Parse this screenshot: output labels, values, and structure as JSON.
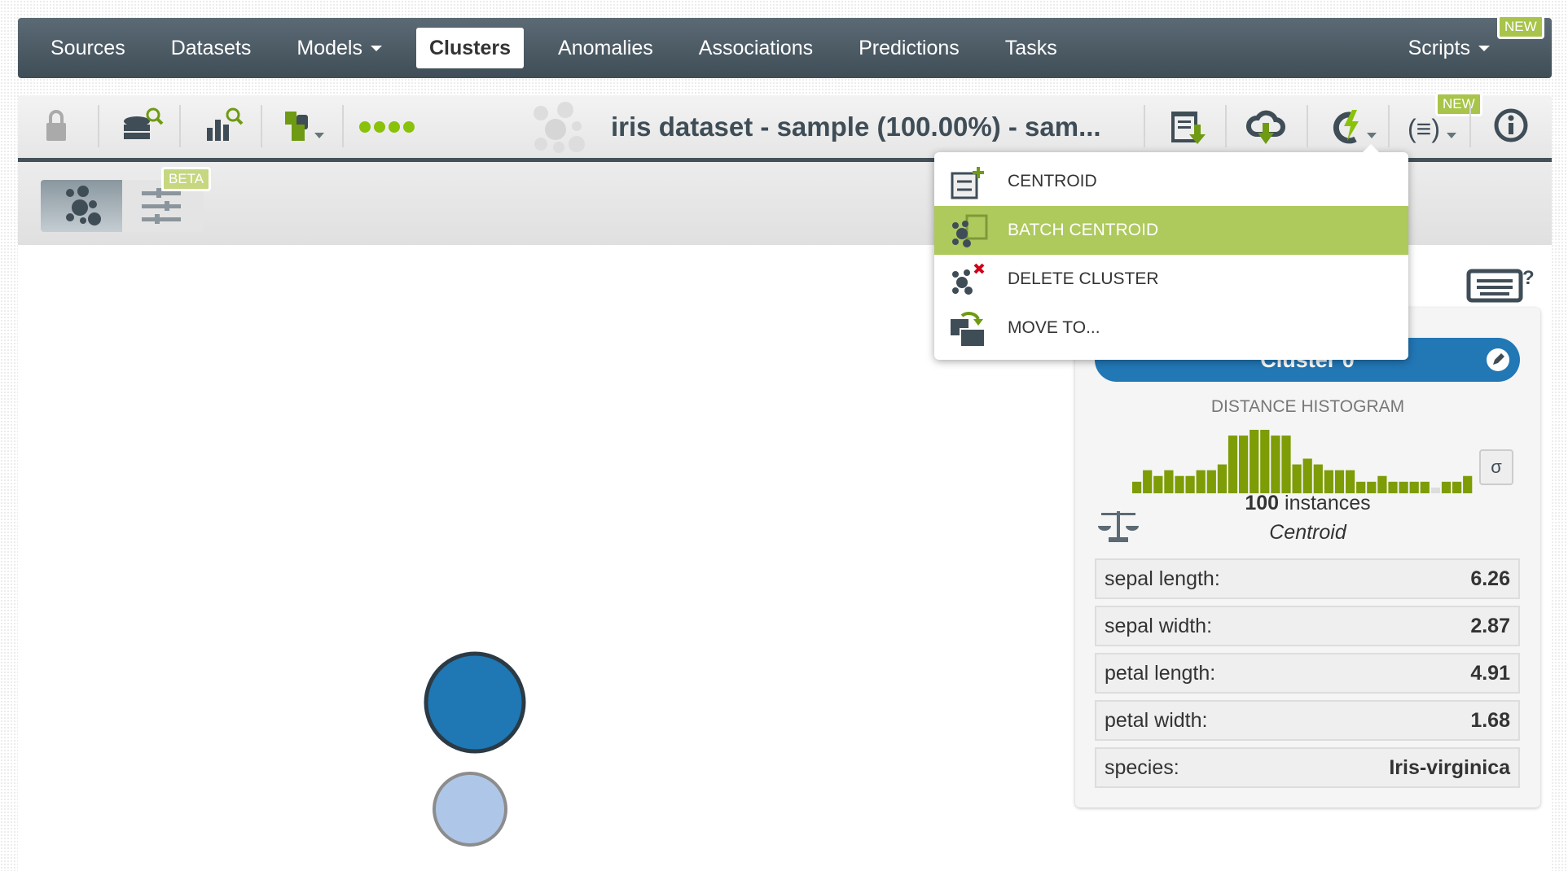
{
  "nav": {
    "items": [
      {
        "label": "Sources"
      },
      {
        "label": "Datasets"
      },
      {
        "label": "Models",
        "dropdown": true
      },
      {
        "label": "Clusters",
        "active": true
      },
      {
        "label": "Anomalies"
      },
      {
        "label": "Associations"
      },
      {
        "label": "Predictions"
      },
      {
        "label": "Tasks"
      }
    ],
    "scripts": "Scripts",
    "new_badge": "NEW"
  },
  "toolbar": {
    "title": "iris dataset - sample (100.00%) - sam...",
    "new_badge": "NEW",
    "icons": [
      "lock-icon",
      "dataset-search-icon",
      "chart-search-icon",
      "model-numbers-icon",
      "progress-dots-icon",
      "clipboard-download-icon",
      "cloud-download-icon",
      "actions-icon",
      "scripts-icon",
      "info-icon"
    ]
  },
  "subtoolbar": {
    "beta_badge": "BETA"
  },
  "menu": {
    "items": [
      {
        "label": "CENTROID"
      },
      {
        "label": "BATCH CENTROID",
        "highlighted": true
      },
      {
        "label": "DELETE CLUSTER"
      },
      {
        "label": "MOVE TO..."
      }
    ]
  },
  "panel": {
    "cluster_name": "Cluster 0",
    "histogram_title": "DISTANCE HISTOGRAM",
    "histogram": [
      2,
      4,
      3,
      4,
      3,
      3,
      4,
      4,
      5,
      10,
      10,
      11,
      11,
      10,
      10,
      5,
      6,
      5,
      4,
      4,
      4,
      2,
      2,
      3,
      2,
      2,
      2,
      2,
      1,
      2,
      2,
      3
    ],
    "sigma": "σ",
    "instances_count": "100",
    "instances_label": "instances",
    "centroid_label": "Centroid",
    "fields": [
      {
        "name": "sepal length:",
        "value": "6.26"
      },
      {
        "name": "sepal width:",
        "value": "2.87"
      },
      {
        "name": "petal length:",
        "value": "4.91"
      },
      {
        "name": "petal width:",
        "value": "1.68"
      },
      {
        "name": "species:",
        "value": "Iris-virginica"
      }
    ]
  },
  "colors": {
    "accent": "#aec95c",
    "cluster_selected": "#1f77b4",
    "cluster_other": "#aec7e8",
    "nav": "#44515a"
  }
}
